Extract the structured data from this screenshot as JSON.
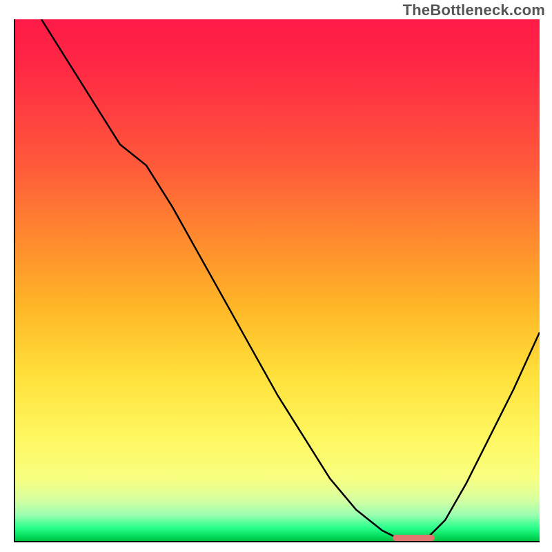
{
  "watermark": "TheBottleneck.com",
  "chart_data": {
    "type": "line",
    "title": "",
    "xlabel": "",
    "ylabel": "",
    "xlim": [
      0,
      100
    ],
    "ylim": [
      0,
      100
    ],
    "grid": false,
    "legend": false,
    "background_gradient": {
      "direction": "vertical",
      "stops": [
        {
          "pos": 0,
          "color": "#ff1a47"
        },
        {
          "pos": 28,
          "color": "#ff5a3a"
        },
        {
          "pos": 55,
          "color": "#ffb627"
        },
        {
          "pos": 80,
          "color": "#fff760"
        },
        {
          "pos": 95,
          "color": "#9cffb0"
        },
        {
          "pos": 100,
          "color": "#00c040"
        }
      ]
    },
    "series": [
      {
        "name": "bottleneck-curve",
        "x": [
          5,
          10,
          15,
          20,
          25,
          30,
          35,
          40,
          45,
          50,
          55,
          60,
          65,
          70,
          74,
          78,
          82,
          86,
          90,
          95,
          100
        ],
        "y": [
          100,
          92,
          84,
          76,
          72,
          64,
          55,
          46,
          37,
          28,
          20,
          12,
          6,
          2,
          0,
          0,
          4,
          11,
          19,
          29,
          40
        ]
      }
    ],
    "marker": {
      "name": "optimal-range",
      "x_start": 72,
      "x_end": 80,
      "y": 0,
      "color": "#e0746e"
    },
    "axes": {
      "left": true,
      "bottom": true,
      "right": false,
      "top": false,
      "ticks": "none"
    }
  }
}
